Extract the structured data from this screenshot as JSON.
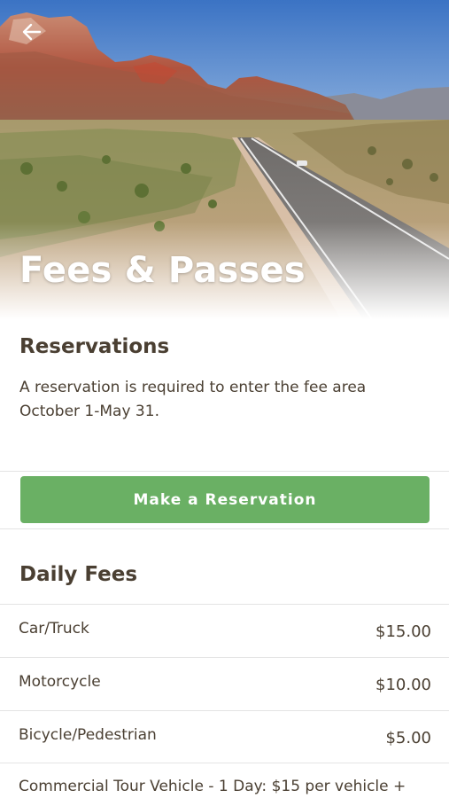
{
  "header": {
    "title": "Fees & Passes",
    "back_icon": "arrow-left-icon"
  },
  "reservations": {
    "title": "Reservations",
    "description": "A reservation is required to enter the fee area October 1-May 31.",
    "button_label": "Make a Reservation",
    "button_color": "#6ab064"
  },
  "daily_fees": {
    "title": "Daily Fees",
    "items": [
      {
        "name": "Car/Truck",
        "price": "$15.00"
      },
      {
        "name": "Motorcycle",
        "price": "$10.00"
      },
      {
        "name": "Bicycle/Pedestrian",
        "price": "$5.00"
      },
      {
        "name": "Commercial Tour Vehicle - 1 Day: $15 per vehicle +",
        "price": ""
      }
    ]
  },
  "colors": {
    "text": "#4a3f32",
    "divider": "#e4e4e4",
    "background": "#ffffff"
  }
}
